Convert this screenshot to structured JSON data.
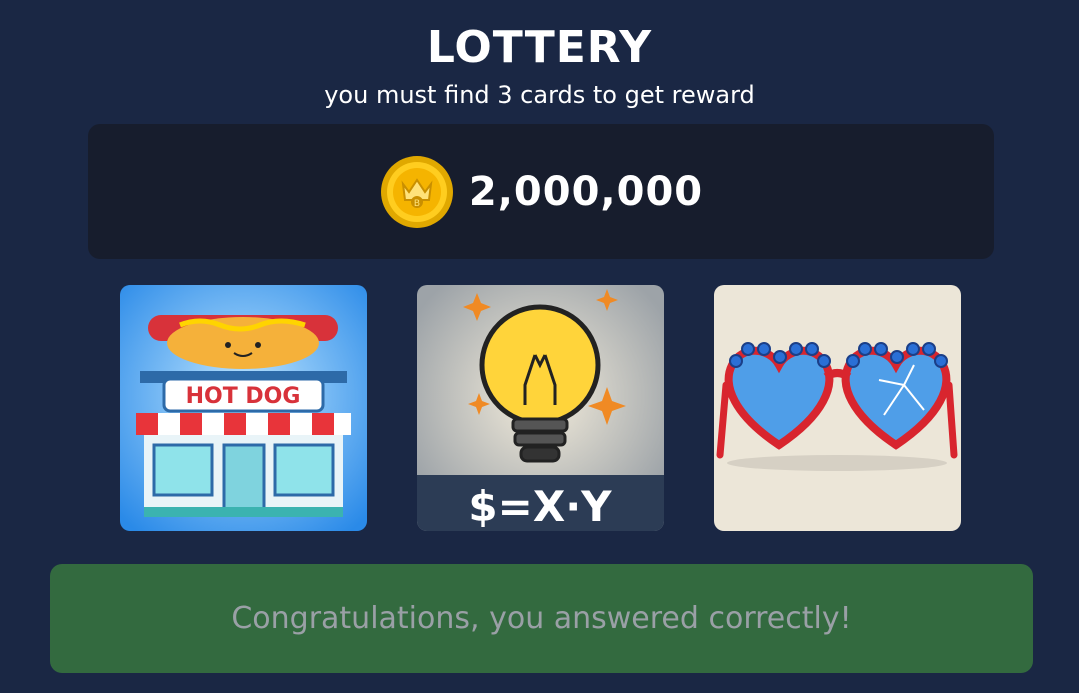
{
  "header": {
    "title": "LOTTERY",
    "subtitle": "you must find 3 cards to get reward"
  },
  "reward": {
    "icon": "gold-coin-icon",
    "amount": "2,000,000"
  },
  "cards": [
    {
      "name": "hot-dog-card",
      "sign_text": "HOT DOG"
    },
    {
      "name": "lightbulb-formula-card",
      "formula_text": "$=X·Y"
    },
    {
      "name": "heart-sunglasses-card"
    }
  ],
  "result": {
    "message": "Congratulations, you answered correctly!"
  },
  "colors": {
    "background": "#1a2744",
    "panel": "#171d2d",
    "success": "#336a3f"
  }
}
